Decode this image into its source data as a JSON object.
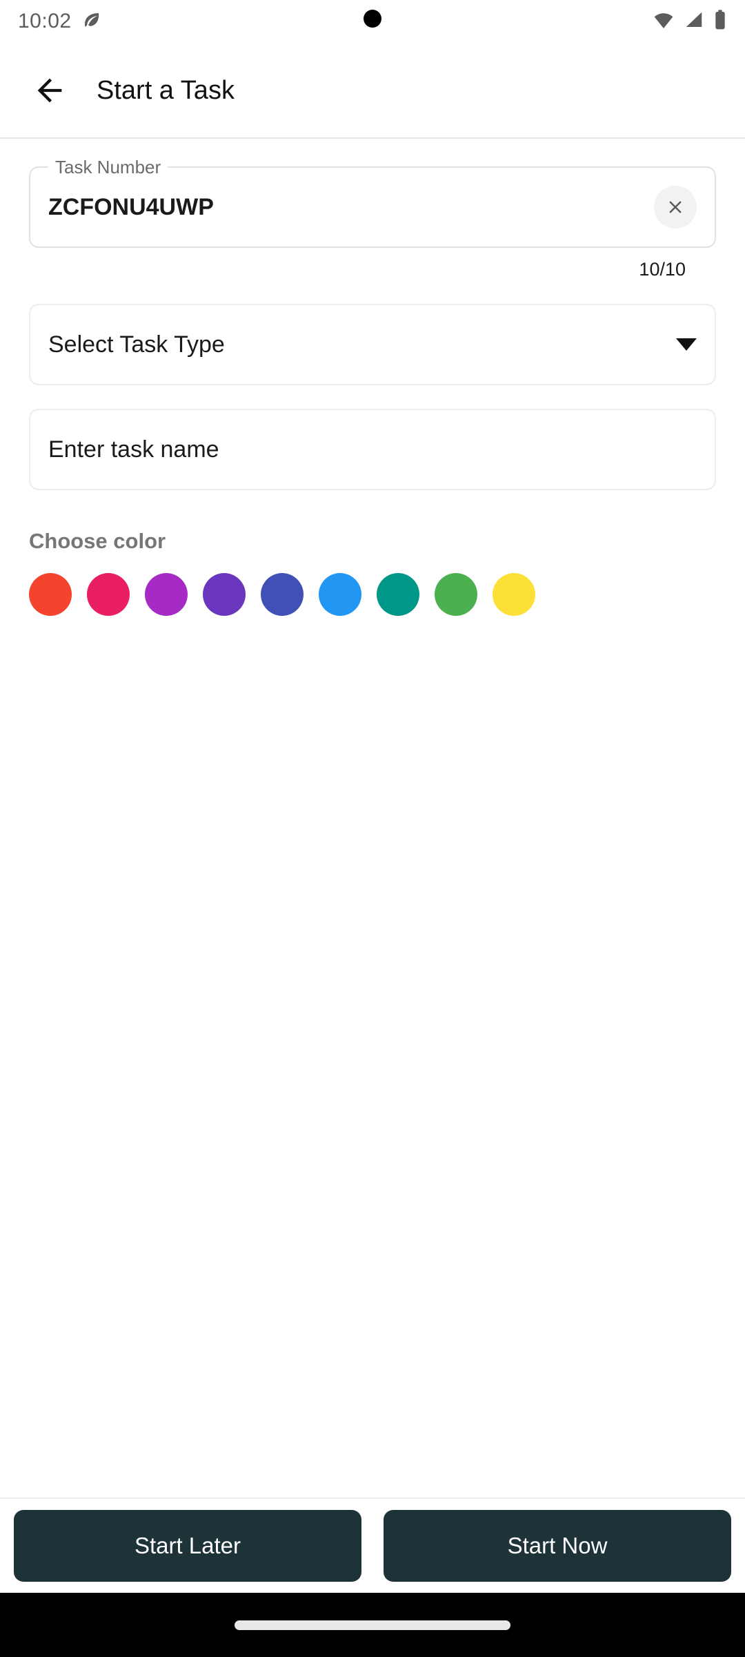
{
  "status_bar": {
    "time": "10:02",
    "leaf_icon": "leaf-icon",
    "wifi_icon": "wifi-icon",
    "signal_icon": "cell-signal-icon",
    "battery_icon": "battery-icon"
  },
  "header": {
    "back_icon": "back-arrow-icon",
    "title": "Start a Task"
  },
  "task_number_field": {
    "label": "Task Number",
    "value": "ZCFONU4UWP",
    "clear_icon": "close-icon",
    "counter": "10/10"
  },
  "task_type_field": {
    "placeholder": "Select Task Type",
    "chevron_icon": "chevron-down-icon"
  },
  "task_name_field": {
    "placeholder": "Enter task name"
  },
  "color_section": {
    "label": "Choose color",
    "swatches": [
      {
        "name": "color-swatch-red",
        "hex": "#F4442E"
      },
      {
        "name": "color-swatch-pink",
        "hex": "#E91E63"
      },
      {
        "name": "color-swatch-magenta",
        "hex": "#A62BC4"
      },
      {
        "name": "color-swatch-violet",
        "hex": "#6B36BE"
      },
      {
        "name": "color-swatch-indigo",
        "hex": "#4050B5"
      },
      {
        "name": "color-swatch-blue",
        "hex": "#2196F3"
      },
      {
        "name": "color-swatch-teal",
        "hex": "#009688"
      },
      {
        "name": "color-swatch-green",
        "hex": "#4CAF50"
      },
      {
        "name": "color-swatch-yellow",
        "hex": "#FCE038"
      }
    ]
  },
  "actions": {
    "start_later": "Start Later",
    "start_now": "Start Now",
    "button_color": "#1E3338"
  },
  "nav_bar": {
    "handle": "gesture-handle"
  }
}
